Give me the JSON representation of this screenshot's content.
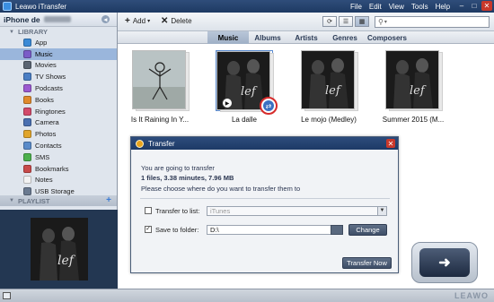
{
  "app": {
    "title": "Leawo iTransfer"
  },
  "menu": [
    "File",
    "Edit",
    "View",
    "Tools",
    "Help"
  ],
  "sidebar": {
    "device": "iPhone de",
    "library_label": "LIBRARY",
    "items": [
      {
        "label": "App",
        "color": "#3a8ad6"
      },
      {
        "label": "Music",
        "color": "#7a5cc8"
      },
      {
        "label": "Movies",
        "color": "#5a6472"
      },
      {
        "label": "TV Shows",
        "color": "#4a7ec4"
      },
      {
        "label": "Podcasts",
        "color": "#9b59d0"
      },
      {
        "label": "Books",
        "color": "#e08a2c"
      },
      {
        "label": "Ringtones",
        "color": "#d24a6a"
      },
      {
        "label": "Camera",
        "color": "#4a6fb0"
      },
      {
        "label": "Photos",
        "color": "#e0a52c"
      },
      {
        "label": "Contacts",
        "color": "#5a8bc9"
      },
      {
        "label": "SMS",
        "color": "#4cb04c"
      },
      {
        "label": "Bookmarks",
        "color": "#c84a4a"
      },
      {
        "label": "Notes",
        "color": "#f2f2f2"
      },
      {
        "label": "USB Storage",
        "color": "#6a7a90"
      }
    ],
    "playlist_label": "PLAYLIST"
  },
  "toolbar": {
    "add_label": "Add",
    "delete_label": "Delete"
  },
  "tabs": [
    "Music",
    "Albums",
    "Artists",
    "Genres",
    "Composers"
  ],
  "songs": [
    {
      "title": "Is It Raining In Y..."
    },
    {
      "title": "La dalle"
    },
    {
      "title": "Le mojo (Medley)"
    },
    {
      "title": "Summer 2015 (M..."
    }
  ],
  "dialog": {
    "title": "Transfer",
    "line1": "You are going to transfer",
    "line2": "1 files, 3.38 minutes, 7.96 MB",
    "line3": "Please choose where do you want to transfer them to",
    "list_label": "Transfer to list:",
    "list_value": "iTunes",
    "folder_label": "Save to folder:",
    "folder_value": "D:\\",
    "change_button": "Change",
    "transfer_button": "Transfer Now"
  },
  "statusbar": {
    "brand": "LEAWO"
  }
}
